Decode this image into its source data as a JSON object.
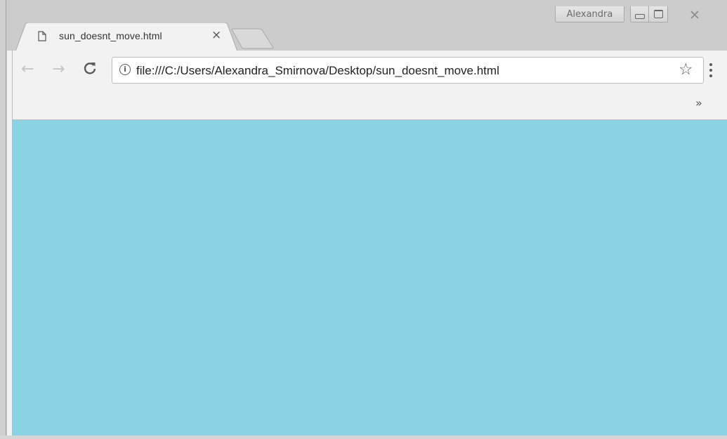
{
  "window": {
    "profile_name": "Alexandra",
    "frame_color": "#cccccc"
  },
  "tab": {
    "title": "sun_doesnt_move.html",
    "close_glyph": "×",
    "icon": "page-icon"
  },
  "toolbar": {
    "back_glyph": "←",
    "forward_glyph": "→",
    "reload_glyph": "C",
    "info_glyph": "i",
    "url": "file:///C:/Users/Alexandra_Smirnova/Desktop/sun_doesnt_move.html",
    "star_glyph": "☆"
  },
  "bookmarks": {
    "overflow_glyph": "»"
  },
  "page": {
    "background_color": "#8bd3e3"
  }
}
